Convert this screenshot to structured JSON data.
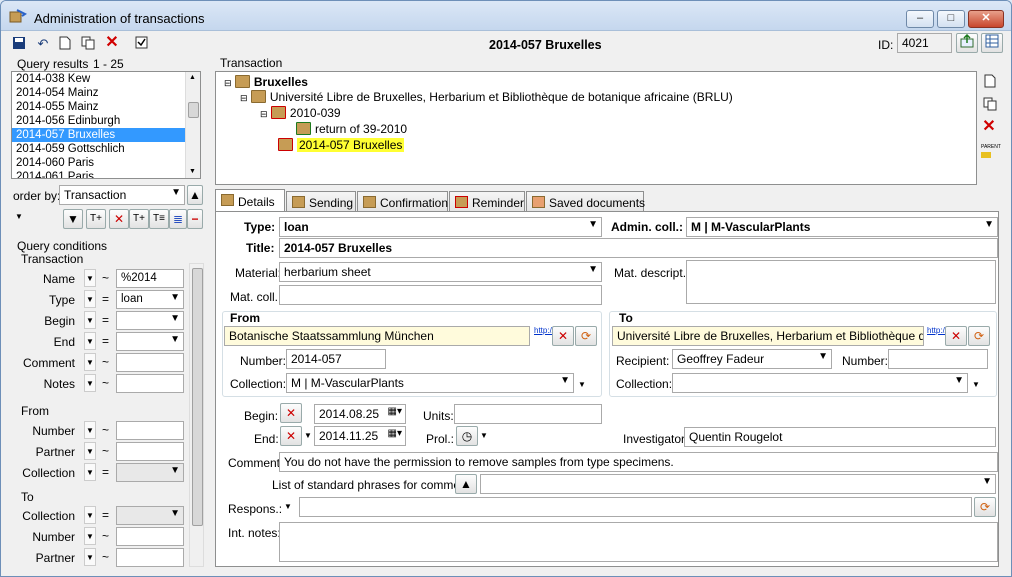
{
  "window": {
    "title": "Administration of transactions",
    "min_label": "–",
    "max_label": "□",
    "close_label": "✕"
  },
  "header": {
    "record_title": "2014-057 Bruxelles",
    "id_label": "ID:",
    "id_value": "4021"
  },
  "left": {
    "query_results_label": "Query results",
    "query_range": "1 - 25",
    "results": [
      "2014-038 Kew",
      "2014-054 Mainz",
      "2014-055 Mainz",
      "2014-056 Edinburgh",
      "2014-057 Bruxelles",
      "2014-059 Gottschlich",
      "2014-060 Paris",
      "2014-061 Paris"
    ],
    "selected_index": 4,
    "order_by_label": "order by:",
    "order_by_value": "Transaction",
    "query_conditions_label": "Query conditions",
    "transaction_group": "Transaction",
    "from_group": "From",
    "to_group": "To",
    "conditions": [
      {
        "label": "Name",
        "op": "~",
        "value": "%2014",
        "kind": "text"
      },
      {
        "label": "Type",
        "op": "=",
        "value": "loan",
        "kind": "combo"
      },
      {
        "label": "Begin",
        "op": "=",
        "value": "",
        "kind": "combo"
      },
      {
        "label": "End",
        "op": "=",
        "value": "",
        "kind": "combo"
      },
      {
        "label": "Comment",
        "op": "~",
        "value": "",
        "kind": "text"
      },
      {
        "label": "Notes",
        "op": "~",
        "value": "",
        "kind": "text"
      }
    ],
    "from_conditions": [
      {
        "label": "Number",
        "op": "~",
        "value": ""
      },
      {
        "label": "Partner",
        "op": "~",
        "value": ""
      },
      {
        "label": "Collection",
        "op": "=",
        "value": ""
      }
    ],
    "to_conditions": [
      {
        "label": "Collection",
        "op": "=",
        "value": ""
      },
      {
        "label": "Number",
        "op": "~",
        "value": ""
      },
      {
        "label": "Partner",
        "op": "~",
        "value": ""
      }
    ]
  },
  "tree": {
    "label": "Transaction",
    "nodes": [
      {
        "text": "Bruxelles",
        "bold": true,
        "highlight": false
      },
      {
        "text": "Université Libre de Bruxelles, Herbarium et Bibliothèque de botanique africaine (BRLU)",
        "bold": false,
        "highlight": false
      },
      {
        "text": "2010-039",
        "bold": false,
        "highlight": false
      },
      {
        "text": "return of 39-2010",
        "bold": false,
        "highlight": false
      },
      {
        "text": "2014-057 Bruxelles",
        "bold": false,
        "highlight": true
      }
    ],
    "side_parent_label": "PARENT"
  },
  "tabs": [
    "Details",
    "Sending",
    "Confirmation",
    "Reminder",
    "Saved documents"
  ],
  "details": {
    "type_label": "Type:",
    "type_value": "loan",
    "admin_coll_label": "Admin. coll.:",
    "admin_coll_value": "M | M-VascularPlants",
    "title_label": "Title:",
    "title_value": "2014-057 Bruxelles",
    "material_label": "Material:",
    "material_value": "herbarium sheet",
    "mat_descript_label": "Mat. descript.:",
    "mat_coll_label": "Mat. coll.:",
    "from": {
      "heading": "From",
      "partner": "Botanische Staatssammlung München",
      "link": "http://id.s",
      "number_label": "Number:",
      "number_value": "2014-057",
      "collection_label": "Collection:",
      "collection_value": "M | M-VascularPlants"
    },
    "to": {
      "heading": "To",
      "partner": "Université Libre de Bruxelles, Herbarium et Bibliothèque de botanique africaine (BRLU)",
      "link": "http://id.s",
      "recipient_label": "Recipient:",
      "recipient_value": "Geoffrey Fadeur",
      "number_label": "Number:",
      "collection_label": "Collection:"
    },
    "begin_label": "Begin:",
    "begin_value": "2014.08.25",
    "units_label": "Units:",
    "end_label": "End:",
    "end_value": "2014.11.25",
    "prol_label": "Prol.:",
    "investigator_label": "Investigator:",
    "investigator_value": "Quentin Rougelot",
    "comment_label": "Comment:",
    "comment_value": "You do not have the permission to remove samples from type specimens.",
    "phrases_label": "List of standard phrases for comment:",
    "respons_label": "Respons.:",
    "int_notes_label": "Int. notes:"
  }
}
